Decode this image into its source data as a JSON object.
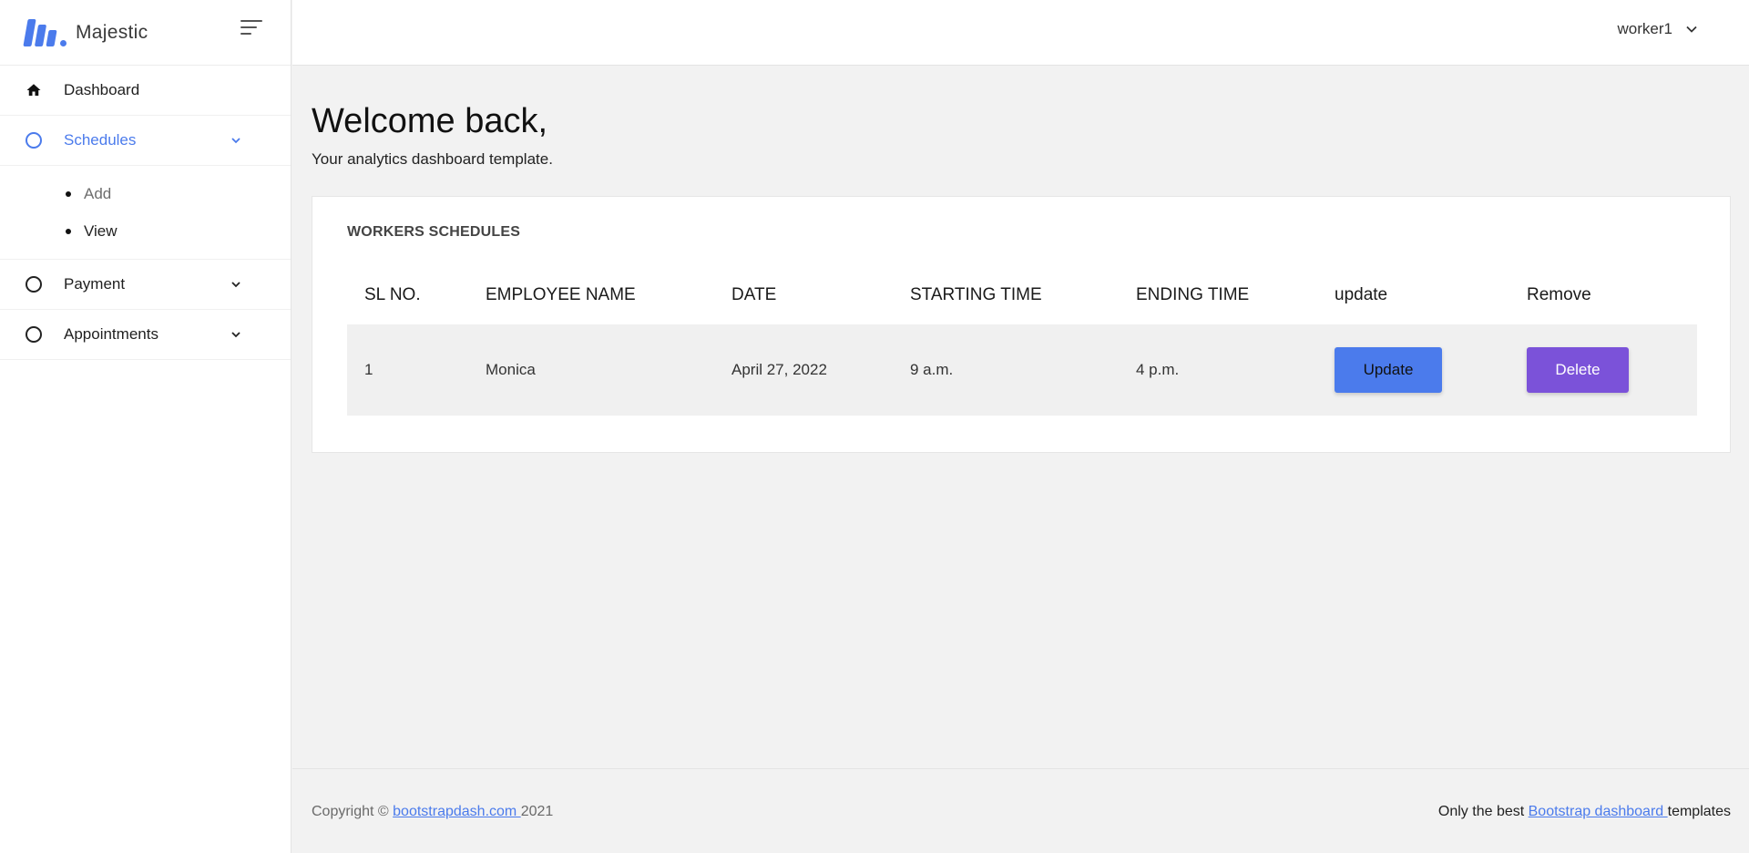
{
  "brand": {
    "name": "Majestic"
  },
  "sidebar": {
    "items": [
      {
        "label": "Dashboard",
        "icon": "home-icon"
      },
      {
        "label": "Schedules",
        "icon": "circle-icon",
        "active": true,
        "sub": [
          "Add",
          "View"
        ]
      },
      {
        "label": "Payment",
        "icon": "circle-icon"
      },
      {
        "label": "Appointments",
        "icon": "circle-icon"
      }
    ]
  },
  "header": {
    "user": "worker1"
  },
  "main": {
    "title": "Welcome back,",
    "subtitle": "Your analytics dashboard template.",
    "card_title": "WORKERS SCHEDULES",
    "columns": [
      "SL NO.",
      "EMPLOYEE NAME",
      "DATE",
      "STARTING TIME",
      "ENDING TIME",
      "update",
      "Remove"
    ],
    "rows": [
      {
        "sl": "1",
        "name": "Monica",
        "date": "April 27, 2022",
        "start": "9 a.m.",
        "end": "4 p.m.",
        "update_label": "Update",
        "delete_label": "Delete"
      }
    ]
  },
  "footer": {
    "left_prefix": "Copyright © ",
    "left_link": "bootstrapdash.com ",
    "left_suffix": "2021",
    "right_prefix": "Only the best ",
    "right_link": "Bootstrap dashboard ",
    "right_suffix": "templates"
  },
  "colors": {
    "accent": "#4b7bec",
    "delete": "#7b52d9"
  }
}
